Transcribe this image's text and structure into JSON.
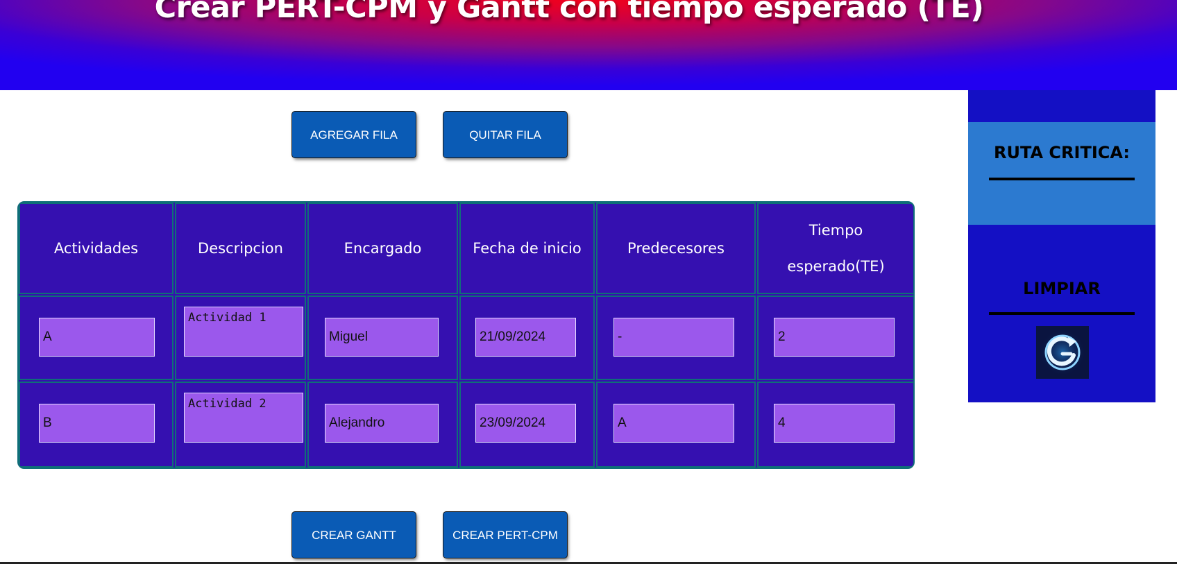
{
  "header": {
    "title": "Crear PERT-CPM y Gantt con tiempo esperado (TE)"
  },
  "toolbar": {
    "add_row": "AGREGAR FILA",
    "remove_row": "QUITAR FILA"
  },
  "table": {
    "headers": [
      "Actividades",
      "Descripcion",
      "Encargado",
      "Fecha de inicio",
      "Predecesores",
      "Tiempo esperado(TE)"
    ],
    "rows": [
      {
        "actividad": "A",
        "descripcion": "Actividad 1",
        "encargado": "Miguel",
        "fecha": "21/09/2024",
        "predecesores": "-",
        "te": "2"
      },
      {
        "actividad": "B",
        "descripcion": "Actividad 2",
        "encargado": "Alejandro",
        "fecha": "23/09/2024",
        "predecesores": "A",
        "te": "4"
      }
    ]
  },
  "actions": {
    "create_gantt": "CREAR GANTT",
    "create_pert": "CREAR PERT-CPM"
  },
  "sidebar": {
    "critical_path_label": "RUTA CRITICA:",
    "clear_label": "LIMPIAR",
    "clear_icon": "refresh-icon"
  },
  "colors": {
    "header_center": "#f2001a",
    "header_edge": "#2200f0",
    "button": "#0a5bb5",
    "table_bg": "#3510b0",
    "table_border": "#0f6e78",
    "input_bg": "#9b58ec",
    "sidebar_bg": "#1410c4",
    "sidebar_highlight": "#2c7ad0"
  }
}
